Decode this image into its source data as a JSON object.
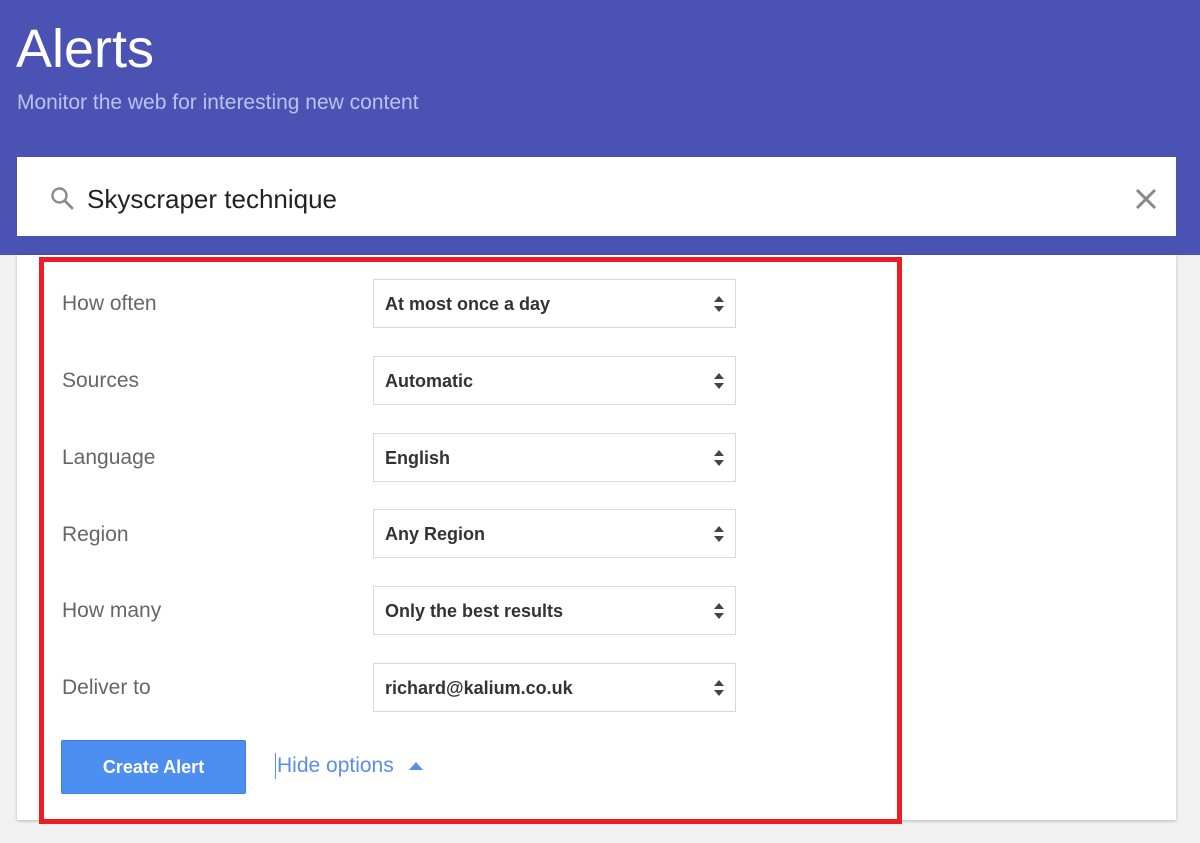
{
  "header": {
    "title": "Alerts",
    "subtitle": "Monitor the web for interesting new content",
    "background_color": "#4a52b4"
  },
  "search": {
    "value": "Skyscraper technique",
    "search_icon": "search-icon",
    "clear_icon": "close-icon"
  },
  "options": {
    "rows": [
      {
        "label": "How often",
        "value": "At most once a day"
      },
      {
        "label": "Sources",
        "value": "Automatic"
      },
      {
        "label": "Language",
        "value": "English"
      },
      {
        "label": "Region",
        "value": "Any Region"
      },
      {
        "label": "How many",
        "value": "Only the best results"
      },
      {
        "label": "Deliver to",
        "value": "richard@kalium.co.uk"
      }
    ],
    "select_arrow_icon": "updown-arrows-icon"
  },
  "actions": {
    "create_label": "Create Alert",
    "create_color": "#4d8ff0",
    "hide_options_label": "Hide options",
    "hide_icon": "caret-up-icon"
  },
  "annotation": {
    "highlight_color": "#ee1c24"
  }
}
